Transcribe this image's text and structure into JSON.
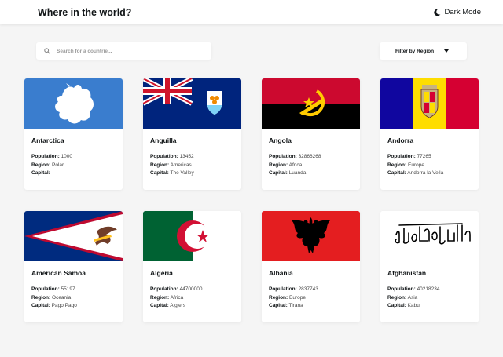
{
  "header": {
    "title": "Where in the world?",
    "mode_label": "Dark Mode"
  },
  "search": {
    "placeholder": "Search for a countrie..."
  },
  "filter": {
    "label": "Filter by Region"
  },
  "labels": {
    "population": "Population:",
    "region": "Region:",
    "capital": "Capital:"
  },
  "countries": [
    {
      "name": "Antarctica",
      "population": "1000",
      "region": "Polar",
      "capital": ""
    },
    {
      "name": "Anguilla",
      "population": "13452",
      "region": "Americas",
      "capital": "The Valley"
    },
    {
      "name": "Angola",
      "population": "32866268",
      "region": "Africa",
      "capital": "Luanda"
    },
    {
      "name": "Andorra",
      "population": "77265",
      "region": "Europe",
      "capital": "Andorra la Vella"
    },
    {
      "name": "American Samoa",
      "population": "55197",
      "region": "Oceania",
      "capital": "Pago Pago"
    },
    {
      "name": "Algeria",
      "population": "44700000",
      "region": "Africa",
      "capital": "Algiers"
    },
    {
      "name": "Albania",
      "population": "2837743",
      "region": "Europe",
      "capital": "Tirana"
    },
    {
      "name": "Afghanistan",
      "population": "40218234",
      "region": "Asia",
      "capital": "Kabul"
    }
  ],
  "flag_icons": [
    "antarctica-flag",
    "anguilla-flag",
    "angola-flag",
    "andorra-flag",
    "american-samoa-flag",
    "algeria-flag",
    "albania-flag",
    "afghanistan-flag"
  ],
  "colors": {
    "background": "#f5f5f5",
    "card": "#ffffff",
    "text": "#111517",
    "flag_antarctica_blue": "#3a7dce",
    "flag_anguilla_navy": "#00247d",
    "flag_angola_red": "#cc092f",
    "flag_andorra_blue": "#10069f",
    "flag_andorra_yellow": "#fedd00",
    "flag_andorra_red": "#d50032",
    "flag_samoa_navy": "#002b7f",
    "flag_algeria_green": "#006233",
    "flag_algeria_red": "#d21034",
    "flag_albania_red": "#e41e20"
  }
}
